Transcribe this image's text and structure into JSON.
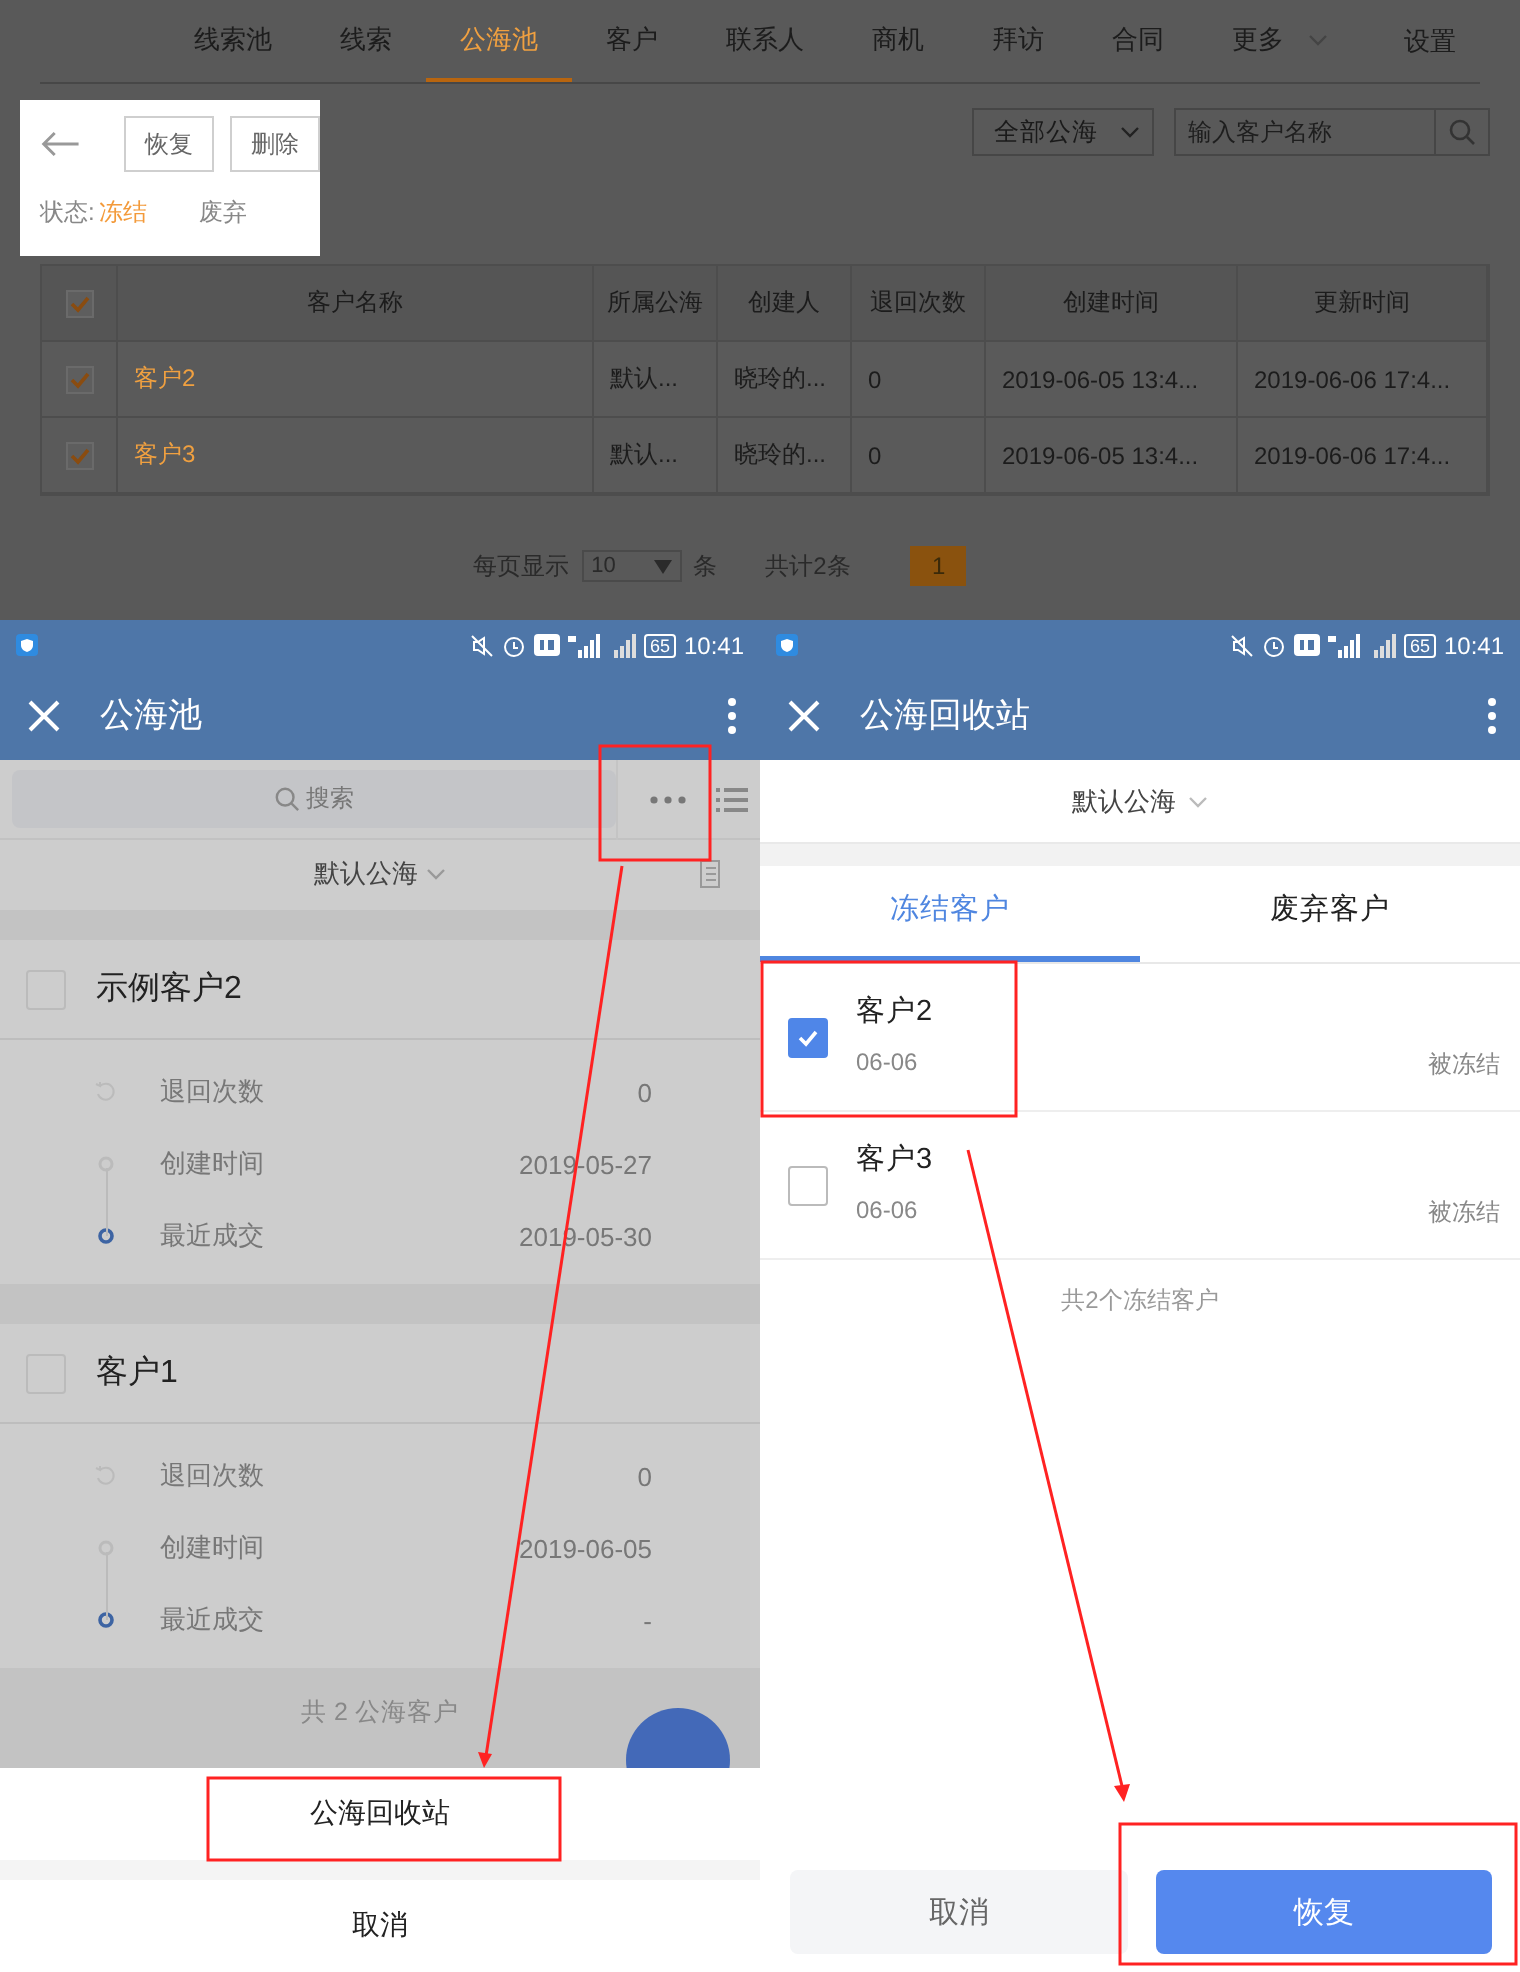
{
  "desktop": {
    "nav": [
      {
        "label": "线索池",
        "kind": "link",
        "selected": false
      },
      {
        "label": "线索",
        "kind": "link",
        "selected": false
      },
      {
        "label": "公海池",
        "kind": "link",
        "selected": true
      },
      {
        "label": "客户",
        "kind": "link",
        "selected": false
      },
      {
        "label": "联系人",
        "kind": "link",
        "selected": false
      },
      {
        "label": "商机",
        "kind": "link",
        "selected": false
      },
      {
        "label": "拜访",
        "kind": "link",
        "selected": false
      },
      {
        "label": "合同",
        "kind": "link",
        "selected": false
      },
      {
        "label": "更多",
        "kind": "dropdown",
        "selected": false
      }
    ],
    "settings": "设置",
    "toolbar": {
      "buttons": [
        "恢复",
        "删除"
      ],
      "status_label": "状态:",
      "statuses": [
        {
          "label": "冻结",
          "selected": true
        },
        {
          "label": "废弃",
          "selected": false
        }
      ]
    },
    "filter": {
      "value": "全部公海"
    },
    "search": {
      "placeholder": "输入客户名称"
    },
    "table": {
      "all_checked": true,
      "columns": [
        "客户名称",
        "所属公海",
        "创建人",
        "退回次数",
        "创建时间",
        "更新时间"
      ],
      "rows": [
        {
          "checked": true,
          "cells": [
            "客户2",
            "默认...",
            "晓玲的...",
            "0",
            "2019-06-05 13:4...",
            "2019-06-06 17:4..."
          ]
        },
        {
          "checked": true,
          "cells": [
            "客户3",
            "默认...",
            "晓玲的...",
            "0",
            "2019-06-05 13:4...",
            "2019-06-06 17:4..."
          ]
        }
      ]
    },
    "pagination": {
      "label": "每页显示",
      "page_size": "10",
      "unit": "条",
      "total": "共计2条",
      "pages": [
        {
          "label": "1",
          "selected": true
        }
      ]
    }
  },
  "left_phone": {
    "status_bar": {
      "battery": "65",
      "time": "10:41"
    },
    "title": "公海池",
    "search": {
      "placeholder": "搜索"
    },
    "pool": "默认公海",
    "customers": [
      {
        "name": "示例客户2",
        "checked": false,
        "fields": [
          {
            "kind": "returns",
            "label": "退回次数",
            "value": "0"
          },
          {
            "kind": "created",
            "label": "创建时间",
            "value": "2019-05-27"
          },
          {
            "kind": "deal",
            "label": "最近成交",
            "value": "2019-05-30"
          }
        ]
      },
      {
        "name": "客户1",
        "checked": false,
        "fields": [
          {
            "kind": "returns",
            "label": "退回次数",
            "value": "0"
          },
          {
            "kind": "created",
            "label": "创建时间",
            "value": "2019-06-05"
          },
          {
            "kind": "deal",
            "label": "最近成交",
            "value": "-"
          }
        ]
      }
    ],
    "footer": "共 2 公海客户",
    "action_sheet": {
      "items": [
        "公海回收站"
      ],
      "cancel": "取消"
    }
  },
  "right_phone": {
    "status_bar": {
      "battery": "65",
      "time": "10:41"
    },
    "title": "公海回收站",
    "pool": "默认公海",
    "tabs": [
      {
        "label": "冻结客户",
        "selected": true
      },
      {
        "label": "废弃客户",
        "selected": false
      }
    ],
    "customers": [
      {
        "name": "客户2",
        "checked": true,
        "date": "06-06",
        "status": "被冻结"
      },
      {
        "name": "客户3",
        "checked": false,
        "date": "06-06",
        "status": "被冻结"
      }
    ],
    "footer": "共2个冻结客户",
    "buttons": {
      "cancel": "取消",
      "confirm": "恢复"
    }
  }
}
